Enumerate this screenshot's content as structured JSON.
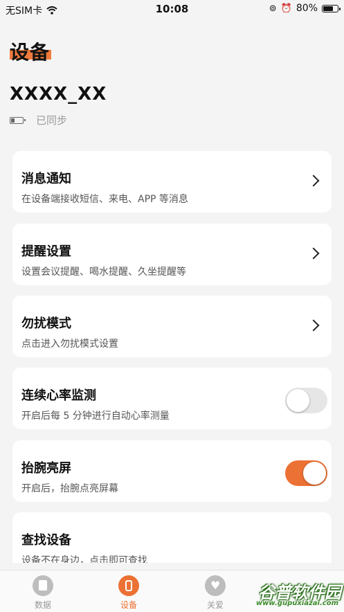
{
  "status_bar": {
    "carrier": "无SIM卡",
    "time": "10:08",
    "battery_percent": "80%",
    "battery_level": 0.8
  },
  "header": {
    "title": "设备"
  },
  "device": {
    "name": "XXXX_XX",
    "sync_status": "已同步"
  },
  "settings": [
    {
      "title": "消息通知",
      "desc": "在设备端接收短信、来电、APP 等消息",
      "control": "chevron"
    },
    {
      "title": "提醒设置",
      "desc": "设置会议提醒、喝水提醒、久坐提醒等",
      "control": "chevron"
    },
    {
      "title": "勿扰模式",
      "desc": "点击进入勿扰模式设置",
      "control": "chevron"
    },
    {
      "title": "连续心率监测",
      "desc": "开启后每 5 分钟进行自动心率测量",
      "control": "toggle",
      "on": false
    },
    {
      "title": "抬腕亮屏",
      "desc": "开启后，抬腕点亮屏幕",
      "control": "toggle",
      "on": true
    },
    {
      "title": "查找设备",
      "desc": "设备不在身边，点击即可查找",
      "control": "none"
    }
  ],
  "tabs": [
    {
      "label": "数据",
      "icon": "document-icon",
      "active": false
    },
    {
      "label": "设备",
      "icon": "watch-icon",
      "active": true
    },
    {
      "label": "关爱",
      "icon": "heart-icon",
      "active": false
    }
  ],
  "watermark": {
    "text": "谷普软件园",
    "url": "www.gupuxiazai.com"
  },
  "colors": {
    "accent": "#ec7134",
    "background": "#f4f4f4",
    "card": "#ffffff"
  }
}
